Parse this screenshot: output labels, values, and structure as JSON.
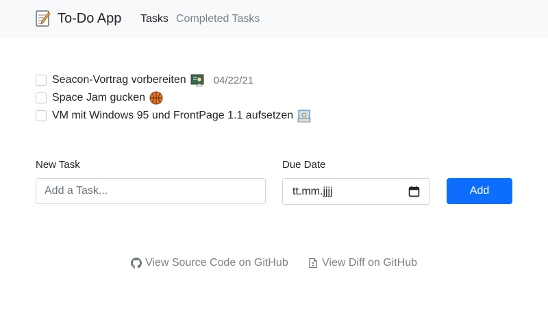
{
  "navbar": {
    "brand_icon": "memo-icon",
    "brand": "To-Do App",
    "links": [
      "Tasks",
      "Completed Tasks"
    ],
    "active": "Tasks"
  },
  "tasks": [
    {
      "text": "Seacon-Vortrag vorbereiten",
      "emoji": "teacher-emoji",
      "date": "04/22/21",
      "checked": false
    },
    {
      "text": "Space Jam gucken",
      "emoji": "basketball-emoji",
      "date": "",
      "checked": false
    },
    {
      "text": "VM mit Windows 95 und FrontPage 1.1 aufsetzen",
      "emoji": "technologist-emoji",
      "date": "",
      "checked": false
    }
  ],
  "form": {
    "task_label": "New Task",
    "task_placeholder": "Add a Task...",
    "task_value": "",
    "date_label": "Due Date",
    "date_value": "tt.mm.jjjj",
    "add_button": "Add"
  },
  "footer": {
    "source_link": "View Source Code on GitHub",
    "diff_link": "View Diff on GitHub"
  },
  "colors": {
    "primary": "#0d6efd",
    "navbar_bg": "#f8f9fa",
    "muted": "#7b8087"
  }
}
